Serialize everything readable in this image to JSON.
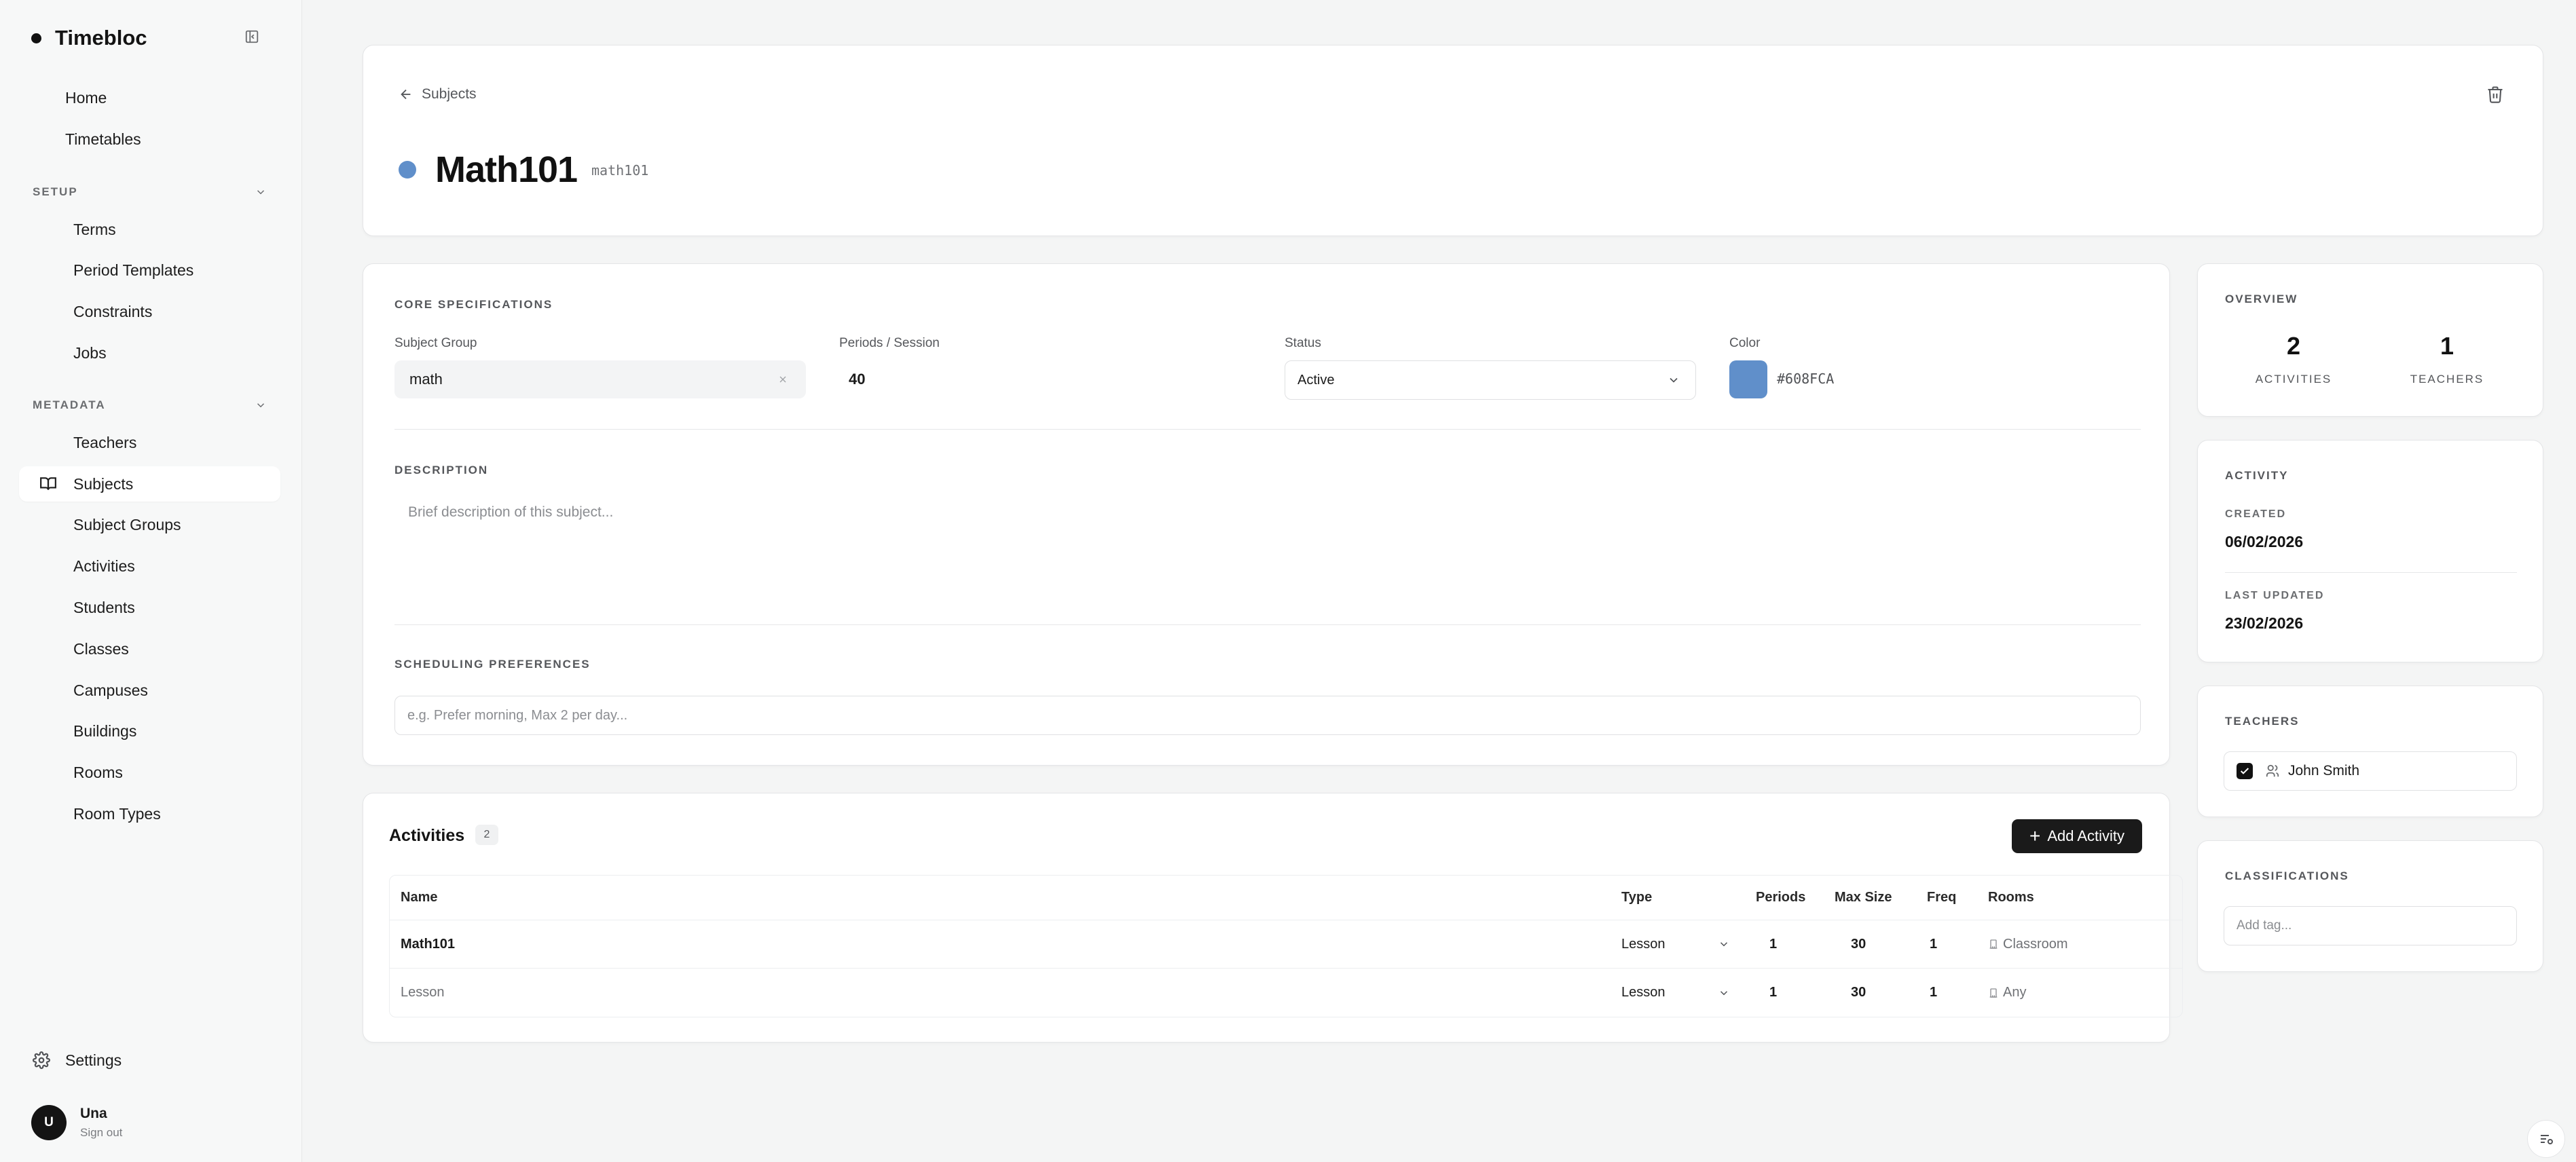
{
  "app": {
    "name": "Timebloc"
  },
  "sidebar": {
    "top_items": [
      {
        "label": "Home"
      },
      {
        "label": "Timetables"
      }
    ],
    "sections": [
      {
        "title": "SETUP",
        "items": [
          {
            "label": "Terms"
          },
          {
            "label": "Period Templates"
          },
          {
            "label": "Constraints"
          },
          {
            "label": "Jobs"
          }
        ]
      },
      {
        "title": "METADATA",
        "items": [
          {
            "label": "Teachers"
          },
          {
            "label": "Subjects",
            "active": true,
            "icon": "book-open-icon"
          },
          {
            "label": "Subject Groups"
          },
          {
            "label": "Activities"
          },
          {
            "label": "Students"
          },
          {
            "label": "Classes"
          },
          {
            "label": "Campuses"
          },
          {
            "label": "Buildings"
          },
          {
            "label": "Rooms"
          },
          {
            "label": "Room Types"
          }
        ]
      }
    ],
    "settings_label": "Settings",
    "user": {
      "initial": "U",
      "name": "Una",
      "action": "Sign out"
    }
  },
  "header": {
    "back_label": "Subjects",
    "title": "Math101",
    "code": "math101",
    "color": "#608FCA"
  },
  "core": {
    "section_title": "CORE SPECIFICATIONS",
    "subject_group": {
      "label": "Subject Group",
      "value": "math"
    },
    "periods": {
      "label": "Periods / Session",
      "value": "40"
    },
    "status": {
      "label": "Status",
      "value": "Active"
    },
    "color": {
      "label": "Color",
      "value": "#608FCA"
    },
    "description": {
      "title": "DESCRIPTION",
      "placeholder": "Brief description of this subject..."
    },
    "scheduling": {
      "title": "SCHEDULING PREFERENCES",
      "placeholder": "e.g. Prefer morning, Max 2 per day..."
    }
  },
  "activities": {
    "title": "Activities",
    "count": "2",
    "add_label": "Add Activity",
    "columns": [
      "Name",
      "Type",
      "Periods",
      "Max Size",
      "Freq",
      "Rooms"
    ],
    "rows": [
      {
        "name": "Math101",
        "type": "Lesson",
        "periods": "1",
        "max_size": "30",
        "freq": "1",
        "rooms": "Classroom",
        "muted": false
      },
      {
        "name": "Lesson",
        "type": "Lesson",
        "periods": "1",
        "max_size": "30",
        "freq": "1",
        "rooms": "Any",
        "muted": true
      }
    ]
  },
  "overview": {
    "title": "OVERVIEW",
    "activities": {
      "value": "2",
      "label": "ACTIVITIES"
    },
    "teachers": {
      "value": "1",
      "label": "TEACHERS"
    }
  },
  "activity": {
    "title": "ACTIVITY",
    "created_label": "CREATED",
    "created": "06/02/2026",
    "updated_label": "LAST UPDATED",
    "updated": "23/02/2026"
  },
  "teachers": {
    "title": "TEACHERS",
    "items": [
      {
        "name": "John Smith",
        "checked": true
      }
    ]
  },
  "classifications": {
    "title": "CLASSIFICATIONS",
    "placeholder": "Add tag..."
  }
}
